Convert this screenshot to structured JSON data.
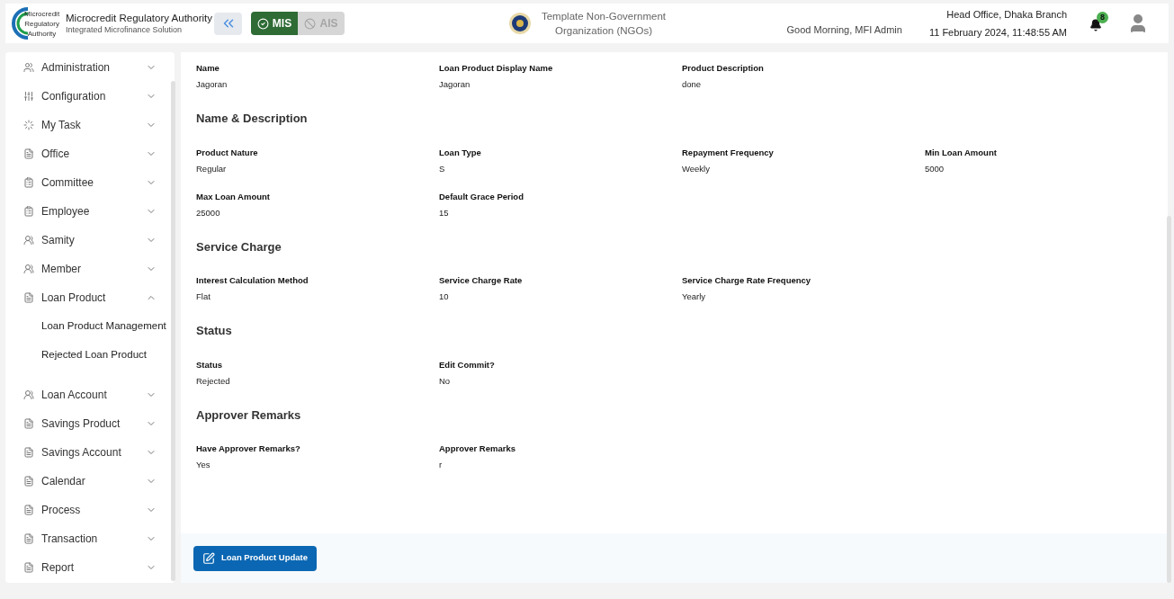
{
  "brand": {
    "title": "Microcredit Regulatory Authority",
    "subtitle": "Integrated Microfinance Solution",
    "logo_text": [
      "Microcredit",
      "Regulatory",
      "Authority"
    ]
  },
  "modes": [
    {
      "label": "MIS",
      "selected": true
    },
    {
      "label": "AIS",
      "selected": false
    }
  ],
  "organization": {
    "name": "Template Non-Government Organization (NGOs)"
  },
  "greeting": "Good Morning, MFI Admin",
  "branch": "Head Office, Dhaka Branch",
  "datetime": "11 February 2024, 11:48:55 AM",
  "notifications": {
    "count": "8"
  },
  "sidebar": {
    "items": [
      {
        "label": "Administration",
        "expanded": false
      },
      {
        "label": "Configuration",
        "expanded": false
      },
      {
        "label": "My Task",
        "expanded": false
      },
      {
        "label": "Office",
        "expanded": false
      },
      {
        "label": "Committee",
        "expanded": false
      },
      {
        "label": "Employee",
        "expanded": false
      },
      {
        "label": "Samity",
        "expanded": false
      },
      {
        "label": "Member",
        "expanded": false
      },
      {
        "label": "Loan Product",
        "expanded": true,
        "children": [
          {
            "label": "Loan Product Management"
          },
          {
            "label": "Rejected Loan Product"
          }
        ]
      },
      {
        "label": "Loan Account",
        "expanded": false
      },
      {
        "label": "Savings Product",
        "expanded": false
      },
      {
        "label": "Savings Account",
        "expanded": false
      },
      {
        "label": "Calendar",
        "expanded": false
      },
      {
        "label": "Process",
        "expanded": false
      },
      {
        "label": "Transaction",
        "expanded": false
      },
      {
        "label": "Report",
        "expanded": false
      }
    ]
  },
  "sections": [
    {
      "fields": [
        {
          "label": "Name",
          "value": "Jagoran"
        },
        {
          "label": "Loan Product Display Name",
          "value": "Jagoran"
        },
        {
          "label": "Product Description",
          "value": "done"
        }
      ]
    },
    {
      "title": "Name & Description",
      "fields": [
        {
          "label": "Product Nature",
          "value": "Regular"
        },
        {
          "label": "Loan Type",
          "value": "S"
        },
        {
          "label": "Repayment Frequency",
          "value": "Weekly"
        },
        {
          "label": "Min Loan Amount",
          "value": "5000"
        },
        {
          "label": "Max Loan Amount",
          "value": "25000"
        },
        {
          "label": "Default Grace Period",
          "value": "15"
        }
      ]
    },
    {
      "title": "Service Charge",
      "fields": [
        {
          "label": "Interest Calculation Method",
          "value": "Flat"
        },
        {
          "label": "Service Charge Rate",
          "value": "10"
        },
        {
          "label": "Service Charge Rate Frequency",
          "value": "Yearly"
        }
      ]
    },
    {
      "title": "Status",
      "fields": [
        {
          "label": "Status",
          "value": "Rejected"
        },
        {
          "label": "Edit Commit?",
          "value": "No"
        }
      ]
    },
    {
      "title": "Approver Remarks",
      "fields": [
        {
          "label": "Have Approver Remarks?",
          "value": "Yes"
        },
        {
          "label": "Approver Remarks",
          "value": "r"
        }
      ]
    }
  ],
  "update_button": {
    "label": "Loan Product Update"
  }
}
